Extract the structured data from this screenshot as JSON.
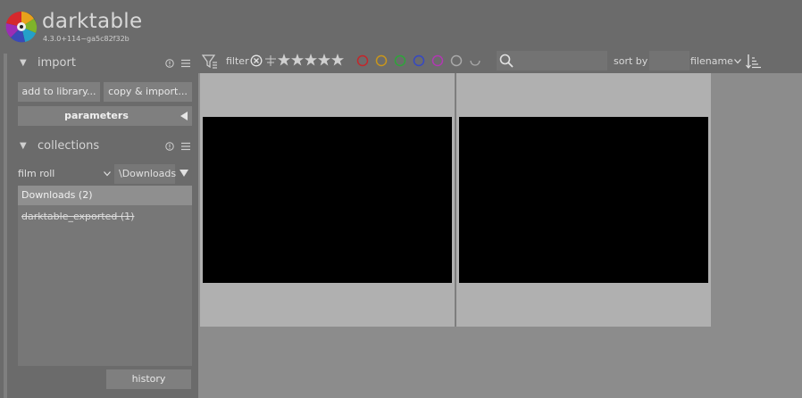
{
  "app": {
    "title": "darktable",
    "version": "4.3.0+114~ga5c82f32b"
  },
  "import": {
    "title": "import",
    "add_to_library": "add to library...",
    "copy_import": "copy & import...",
    "parameters": "parameters"
  },
  "collections": {
    "title": "collections",
    "property": "film roll",
    "value": "\\Downloads",
    "items": [
      {
        "label": "Downloads (2)"
      },
      {
        "label": "darktable_exported (1)"
      }
    ],
    "history": "history"
  },
  "toolbar": {
    "filter_label": "filter",
    "sort_by_label": "sort by",
    "sort_field": "filename",
    "color_labels": [
      "#c4262a",
      "#c9961c",
      "#2ea53a",
      "#3548c4",
      "#b238b3",
      "#a9a9a9"
    ]
  },
  "thumbnails": [
    {
      "name": "thumbnail-1"
    },
    {
      "name": "thumbnail-2"
    }
  ]
}
